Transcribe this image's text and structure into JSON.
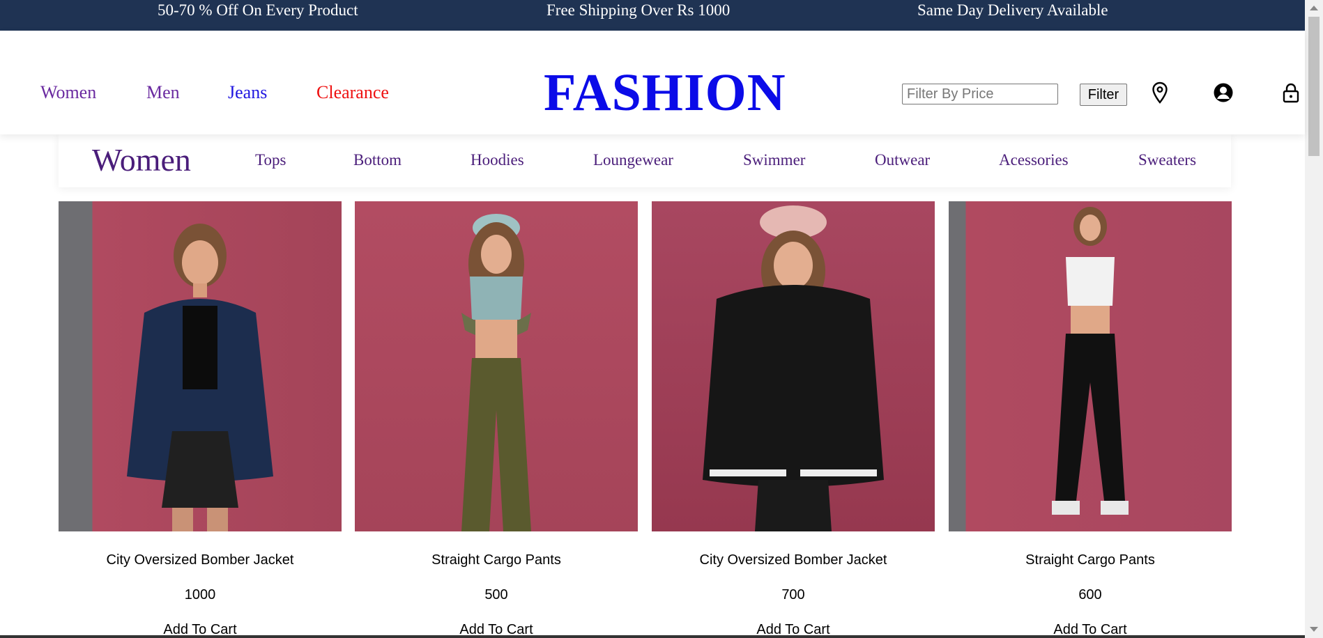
{
  "promo_bar": {
    "left": "50-70 % Off On Every Product",
    "center": "Free Shipping Over Rs 1000",
    "right": "Same Day Delivery Available"
  },
  "header": {
    "nav": [
      {
        "label": "Women",
        "color": "#6a2aa0"
      },
      {
        "label": "Men",
        "color": "#6a2aa0"
      },
      {
        "label": "Jeans",
        "color": "#1f16e0"
      },
      {
        "label": "Clearance",
        "color": "#ee1111"
      }
    ],
    "logo": "FASHION",
    "logo_color": "#0b0be8",
    "filter_placeholder": "Filter By Price",
    "filter_button": "Filter",
    "icons": [
      "location-pin-icon",
      "user-account-icon",
      "lock-icon"
    ]
  },
  "category_nav": {
    "title": "Women",
    "items": [
      "Tops",
      "Bottom",
      "Hoodies",
      "Loungewear",
      "Swimmer",
      "Outwear",
      "Acessories",
      "Sweaters"
    ]
  },
  "products": [
    {
      "name": "City Oversized Bomber Jacket",
      "price": "1000",
      "cta": "Add To Cart"
    },
    {
      "name": "Straight Cargo Pants",
      "price": "500",
      "cta": "Add To Cart"
    },
    {
      "name": "City Oversized Bomber Jacket",
      "price": "700",
      "cta": "Add To Cart"
    },
    {
      "name": "Straight Cargo Pants",
      "price": "600",
      "cta": "Add To Cart"
    }
  ],
  "colors": {
    "promo_bg": "#1f3353",
    "accent_purple": "#4a1d7a",
    "photo_bg": "#a8455a"
  }
}
